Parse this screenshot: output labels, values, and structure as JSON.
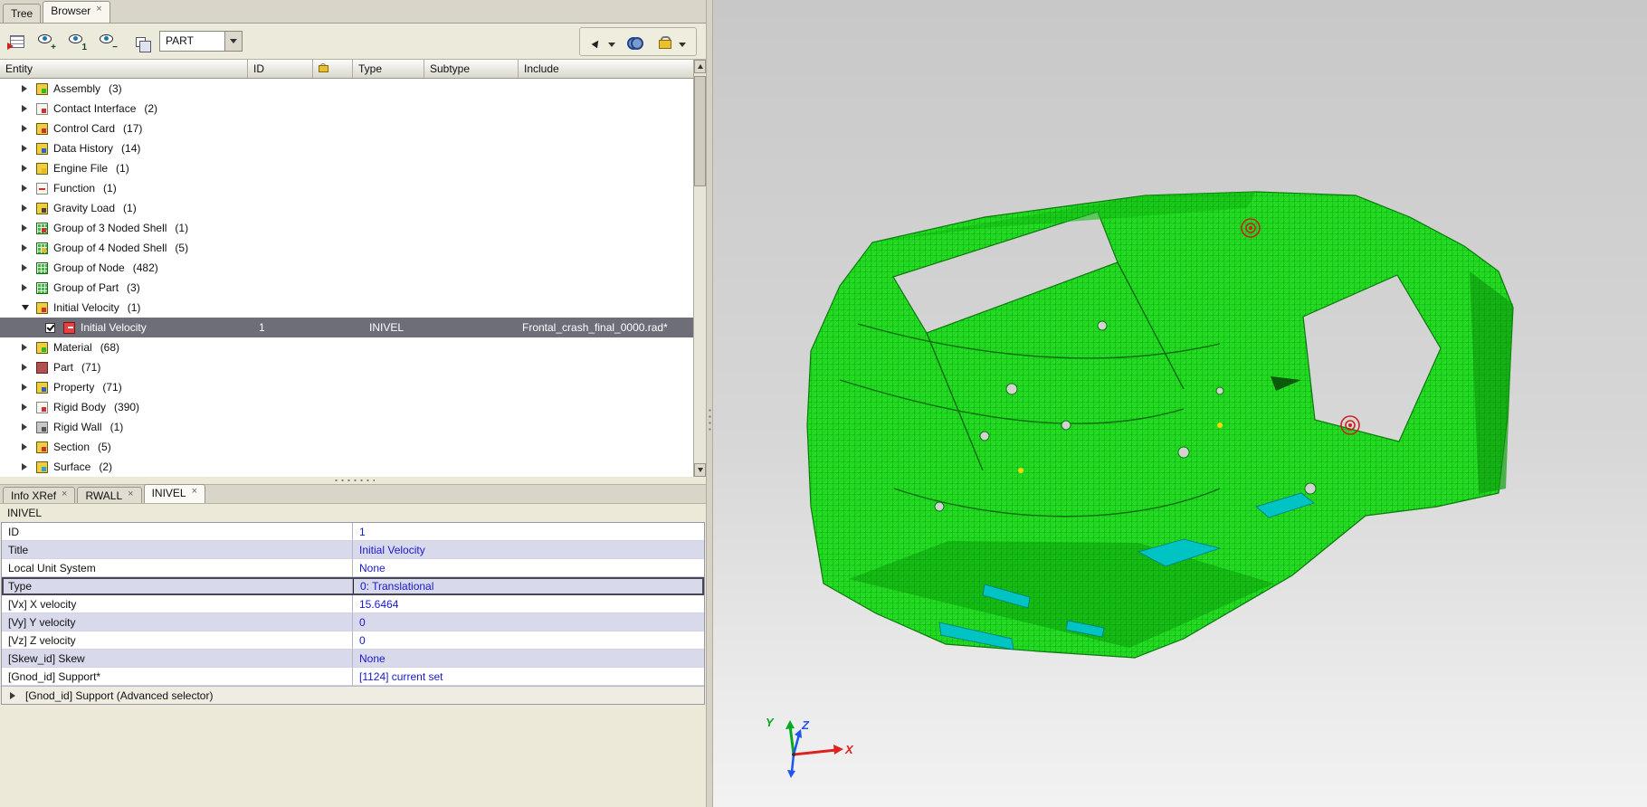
{
  "ui": {
    "close_glyph": "×"
  },
  "tabs_top": [
    {
      "label": "Tree",
      "active": false,
      "closable": false
    },
    {
      "label": "Browser",
      "active": true,
      "closable": true
    }
  ],
  "toolbar": {
    "filter_value": "PART",
    "show_overlay": "+",
    "isolate_overlay": "1",
    "hide_overlay": "−",
    "icons": [
      "entity-hierarchy-icon",
      "show-entities-icon",
      "isolate-entities-icon",
      "hide-entities-icon",
      "copy-layers-icon",
      "filter-combobox",
      "selector-mode-icon",
      "find-icon",
      "lock-icon"
    ]
  },
  "tree": {
    "columns": [
      "Entity",
      "ID",
      "Type",
      "Subtype",
      "Include"
    ],
    "items": [
      {
        "label": "Assembly",
        "count": "(3)",
        "icon": "assembly"
      },
      {
        "label": "Contact Interface",
        "count": "(2)",
        "icon": "contact-interface"
      },
      {
        "label": "Control Card",
        "count": "(17)",
        "icon": "control-card"
      },
      {
        "label": "Data History",
        "count": "(14)",
        "icon": "data-history"
      },
      {
        "label": "Engine File",
        "count": "(1)",
        "icon": "engine-file"
      },
      {
        "label": "Function",
        "count": "(1)",
        "icon": "function"
      },
      {
        "label": "Gravity Load",
        "count": "(1)",
        "icon": "gravity-load"
      },
      {
        "label": "Group of 3 Noded Shell",
        "count": "(1)",
        "icon": "group-shell3"
      },
      {
        "label": "Group of 4 Noded Shell",
        "count": "(5)",
        "icon": "group-shell4"
      },
      {
        "label": "Group of Node",
        "count": "(482)",
        "icon": "group-node"
      },
      {
        "label": "Group of Part",
        "count": "(3)",
        "icon": "group-part"
      },
      {
        "label": "Initial Velocity",
        "count": "(1)",
        "icon": "initial-velocity",
        "expanded": true,
        "children": [
          {
            "label": "Initial Velocity",
            "id": "1",
            "type": "INIVEL",
            "include": "Frontal_crash_final_0000.rad*",
            "checked": true,
            "selected": true,
            "icon": "inivel-item"
          }
        ]
      },
      {
        "label": "Material",
        "count": "(68)",
        "icon": "material"
      },
      {
        "label": "Part",
        "count": "(71)",
        "icon": "part"
      },
      {
        "label": "Property",
        "count": "(71)",
        "icon": "property"
      },
      {
        "label": "Rigid Body",
        "count": "(390)",
        "icon": "rigid-body"
      },
      {
        "label": "Rigid Wall",
        "count": "(1)",
        "icon": "rigid-wall"
      },
      {
        "label": "Section",
        "count": "(5)",
        "icon": "section"
      },
      {
        "label": "Surface",
        "count": "(2)",
        "icon": "surface"
      }
    ]
  },
  "tabs_bottom": [
    {
      "label": "Info XRef",
      "active": false,
      "closable": true
    },
    {
      "label": "RWALL",
      "active": false,
      "closable": true
    },
    {
      "label": "INIVEL",
      "active": true,
      "closable": true
    }
  ],
  "editor": {
    "title": "INIVEL",
    "rows": [
      {
        "label": "ID",
        "value": "1"
      },
      {
        "label": "Title",
        "value": "Initial Velocity",
        "shaded": true
      },
      {
        "label": "Local Unit System",
        "value": "None"
      },
      {
        "label": "Type",
        "value": "0: Translational",
        "shaded": true,
        "selected": true
      },
      {
        "label": "[Vx] X velocity",
        "value": "15.6464"
      },
      {
        "label": "[Vy] Y velocity",
        "value": "0",
        "shaded": true
      },
      {
        "label": "[Vz] Z velocity",
        "value": "0"
      },
      {
        "label": "[Skew_id] Skew",
        "value": "None",
        "shaded": true
      },
      {
        "label": "[Gnod_id] Support*",
        "value": "[1124] current set"
      },
      {
        "label": "[Gnod_id] Support (Advanced selector)",
        "expander": true
      }
    ]
  },
  "viewport": {
    "axis_labels": {
      "x": "X",
      "y": "Y",
      "z": "Z"
    },
    "colors": {
      "model_green": "#22dd22",
      "mesh_line": "#0a7a0a",
      "highlight_cyan": "#00c4c4",
      "marker_red": "#cc2222",
      "background_top": "#c8c8c8",
      "background_bottom": "#f2f2f2"
    }
  }
}
